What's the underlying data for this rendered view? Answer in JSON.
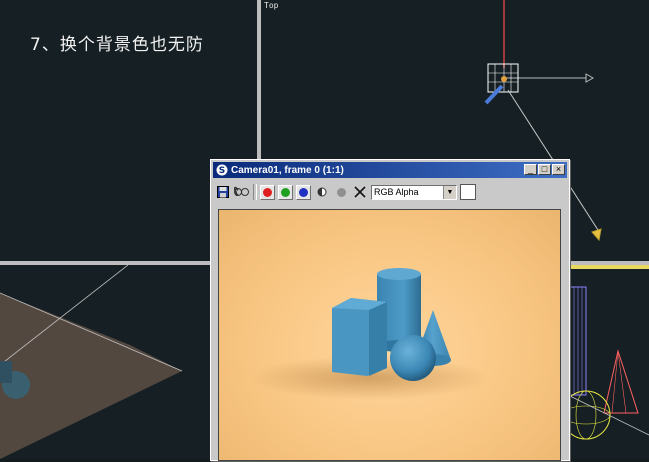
{
  "caption": "7、换个背景色也无防",
  "viewports": {
    "top_label": "Top"
  },
  "render_window": {
    "title": "Camera01, frame 0 (1:1)",
    "channel": {
      "selected": "RGB Alpha"
    },
    "buttons": {
      "minimize": "_",
      "maximize": "□",
      "close": "×"
    },
    "background_color": "#f8c581",
    "toolbar_icons": [
      "save-icon",
      "clone-icon",
      "red-channel-icon",
      "green-channel-icon",
      "blue-channel-icon",
      "mono-icon",
      "alpha-icon",
      "clear-icon"
    ]
  }
}
